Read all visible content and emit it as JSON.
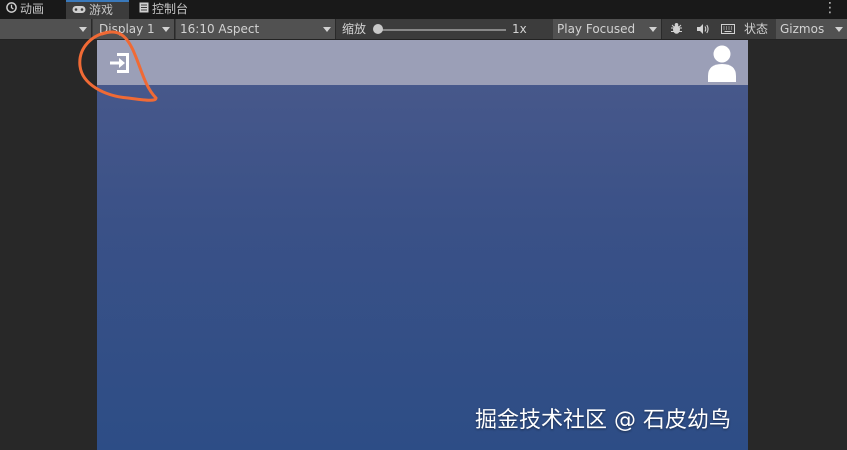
{
  "tabs": [
    {
      "label": "动画",
      "icon": "clock-icon",
      "active": false
    },
    {
      "label": "游戏",
      "icon": "gamepad-icon",
      "active": true
    },
    {
      "label": "控制台",
      "icon": "console-icon",
      "active": false
    }
  ],
  "toolbar": {
    "display": "Display 1",
    "aspect": "16:10 Aspect",
    "scale_label": "缩放",
    "scale_value": "1x",
    "play_mode": "Play Focused",
    "stats_label": "状态",
    "gizmos_label": "Gizmos"
  },
  "game_view": {
    "exit_icon": "login-arrow-icon",
    "avatar_icon": "user-avatar-icon",
    "annotation_color": "#f06a35"
  },
  "watermark": "掘金技术社区 @ 石皮幼鸟"
}
